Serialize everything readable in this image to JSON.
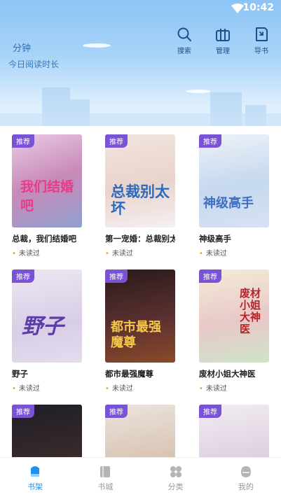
{
  "status_bar": {
    "time": "10:42"
  },
  "header": {
    "reading_minutes_label": "分钟",
    "reading_time_label": "今日阅读时长",
    "tools": [
      {
        "label": "搜索",
        "icon": "search-icon"
      },
      {
        "label": "管理",
        "icon": "manage-icon"
      },
      {
        "label": "导书",
        "icon": "import-icon"
      }
    ]
  },
  "books": [
    {
      "badge": "推荐",
      "title": "总裁，我们结婚吧",
      "status": "未读过",
      "cover_text": "我们结婚吧",
      "cover_color": "#c98ab8"
    },
    {
      "badge": "推荐",
      "title": "第一宠婚：总裁别太坏",
      "status": "未读过",
      "cover_text": "总裁别太坏",
      "cover_color": "#e8d4cc"
    },
    {
      "badge": "推荐",
      "title": "神级高手",
      "status": "未读过",
      "cover_text": "神级高手",
      "cover_color": "#c5d8ee"
    },
    {
      "badge": "推荐",
      "title": "野子",
      "status": "未读过",
      "cover_text": "野子",
      "cover_color": "#d8cde6"
    },
    {
      "badge": "推荐",
      "title": "都市最强魔尊",
      "status": "未读过",
      "cover_text": "都市最强魔尊",
      "cover_color": "#5a3030"
    },
    {
      "badge": "推荐",
      "title": "废材小姐大神医",
      "status": "未读过",
      "cover_text": "废材小姐大神医",
      "cover_color": "#e8c8c8"
    },
    {
      "badge": "推荐",
      "title": "",
      "status": "",
      "cover_text": "",
      "cover_color": "#3a2a2a"
    },
    {
      "badge": "推荐",
      "title": "",
      "status": "",
      "cover_text": "",
      "cover_color": "#d8c4b4"
    },
    {
      "badge": "推荐",
      "title": "",
      "status": "",
      "cover_text": "",
      "cover_color": "#ddd0e0"
    }
  ],
  "tabbar": {
    "tabs": [
      {
        "label": "书架",
        "active": true
      },
      {
        "label": "书城",
        "active": false
      },
      {
        "label": "分类",
        "active": false
      },
      {
        "label": "我的",
        "active": false
      }
    ]
  },
  "colors": {
    "accent": "#1e90f0",
    "badge": "#7a52d6",
    "header_text": "#2f6fb5"
  }
}
